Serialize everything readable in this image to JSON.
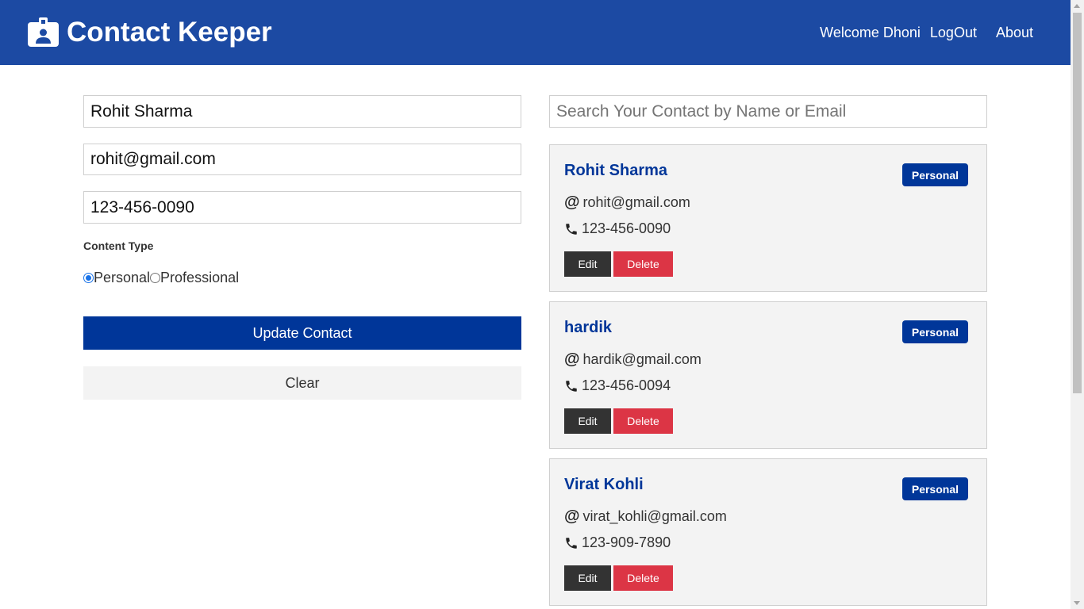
{
  "navbar": {
    "brand_icon": "id-badge-icon",
    "title": "Contact Keeper",
    "welcome": "Welcome Dhoni",
    "logout": "LogOut",
    "about": "About",
    "bg_color": "#1c4aa3"
  },
  "form": {
    "name_value": "Rohit Sharma",
    "email_value": "rohit@gmail.com",
    "phone_value": "123-456-0090",
    "content_type_label": "Content Type",
    "radio_personal": "Personal",
    "radio_professional": "Professional",
    "selected_type": "Personal",
    "update_button": "Update Contact",
    "clear_button": "Clear",
    "accent_color": "#003699"
  },
  "search": {
    "placeholder": "Search Your Contact by Name or Email",
    "value": ""
  },
  "contacts": [
    {
      "name": "Rohit Sharma",
      "email": "rohit@gmail.com",
      "phone": "123-456-0090",
      "type": "Personal",
      "edit": "Edit",
      "delete": "Delete"
    },
    {
      "name": "hardik",
      "email": "hardik@gmail.com",
      "phone": "123-456-0094",
      "type": "Personal",
      "edit": "Edit",
      "delete": "Delete"
    },
    {
      "name": "Virat Kohli",
      "email": "virat_kohli@gmail.com",
      "phone": "123-909-7890",
      "type": "Personal",
      "edit": "Edit",
      "delete": "Delete"
    }
  ],
  "icons": {
    "email": "at-icon",
    "phone": "phone-icon"
  },
  "colors": {
    "delete": "#dc3545",
    "edit": "#333333",
    "card_bg": "#f3f3f3"
  }
}
